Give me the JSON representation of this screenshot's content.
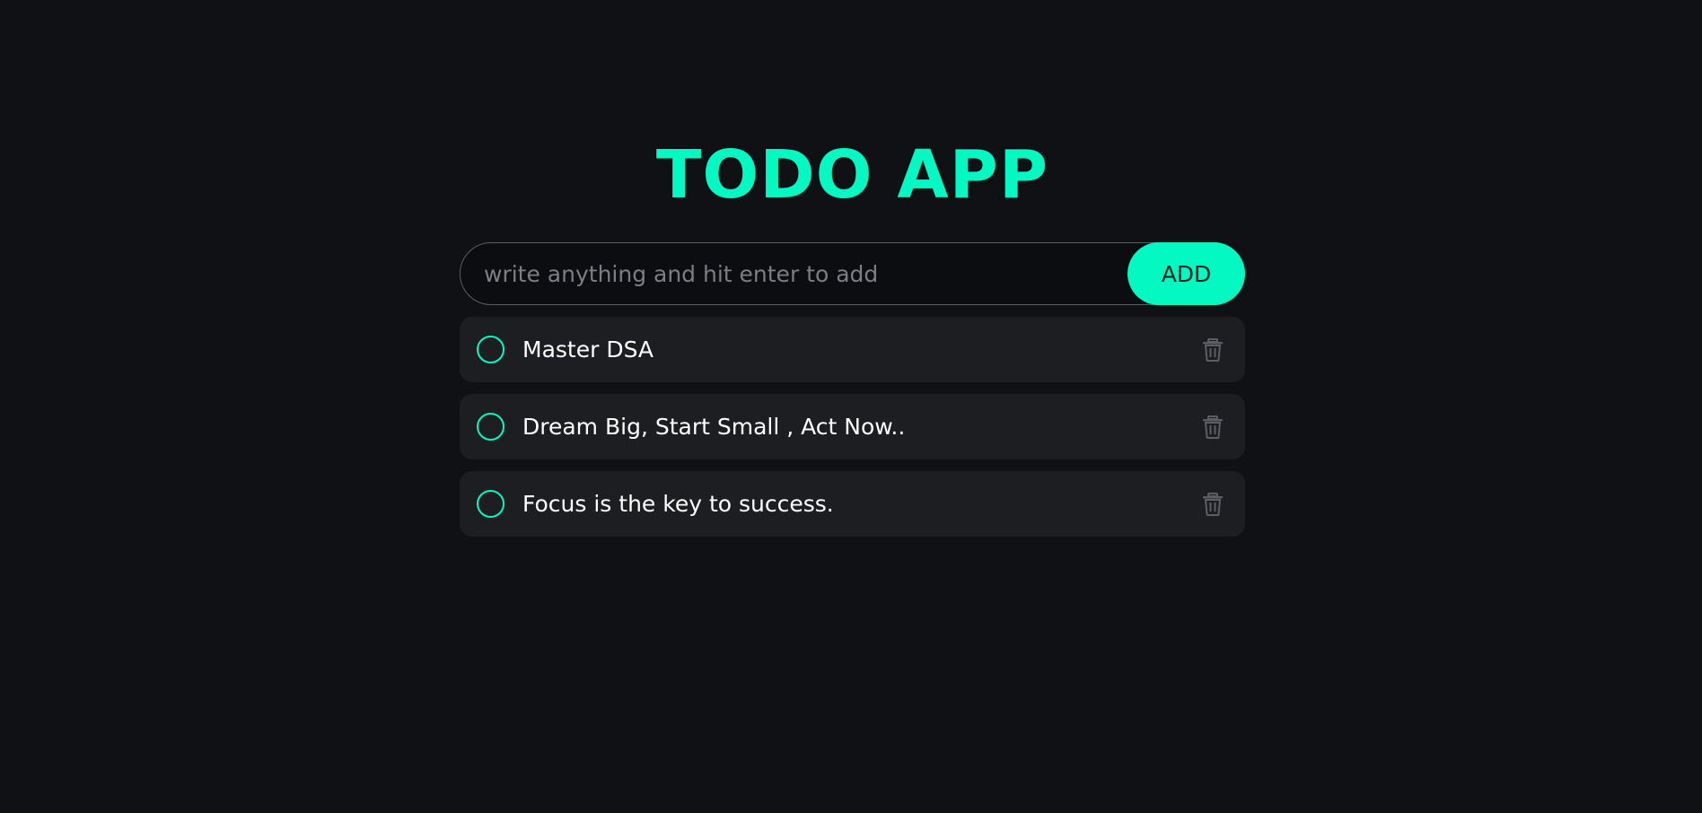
{
  "app": {
    "title": "TODO APP"
  },
  "input": {
    "placeholder": "write anything and hit enter to add",
    "value": ""
  },
  "add_button": {
    "label": "ADD"
  },
  "todos": [
    {
      "text": "Master DSA",
      "completed": false
    },
    {
      "text": "Dream Big, Start Small , Act Now..",
      "completed": false
    },
    {
      "text": "Focus is the key to success.",
      "completed": false
    }
  ],
  "colors": {
    "background": "#101115",
    "accent": "#04f8c2",
    "card": "#1d1e22",
    "delete_icon": "#5b5e63"
  },
  "icons": {
    "checkbox": "circle-outline",
    "delete": "trash-icon"
  }
}
